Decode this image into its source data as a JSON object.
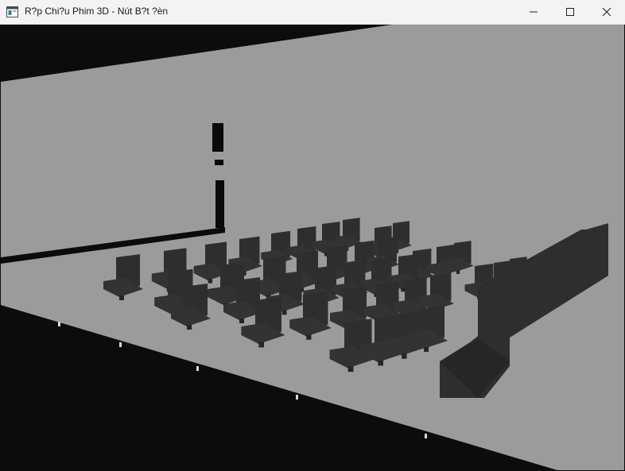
{
  "window": {
    "title": "R?p Chi?u Phim 3D - Nút B?t ?èn",
    "controls": {
      "minimize_icon": "minimize-icon",
      "maximize_icon": "maximize-icon",
      "close_icon": "close-icon"
    }
  },
  "scene": {
    "floor_color": "#9b9b9b",
    "wall_color": "#0c0c0c",
    "seat_color": "#2e2e2e",
    "screen_frame_color": "#0a0a0a"
  }
}
